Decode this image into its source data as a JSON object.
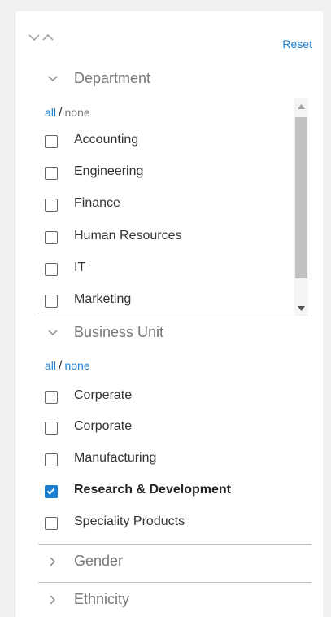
{
  "header": {
    "reset_label": "Reset"
  },
  "sections": [
    {
      "title": "Department",
      "all_label": "all",
      "slash": "/",
      "none_label": "none",
      "items": [
        {
          "label": "Accounting",
          "checked": false
        },
        {
          "label": "Engineering",
          "checked": false
        },
        {
          "label": "Finance",
          "checked": false
        },
        {
          "label": "Human Resources",
          "checked": false
        },
        {
          "label": "IT",
          "checked": false
        },
        {
          "label": "Marketing",
          "checked": false
        }
      ]
    },
    {
      "title": "Business Unit",
      "all_label": "all",
      "slash": "/",
      "none_label": "none",
      "items": [
        {
          "label": "Corperate",
          "checked": false
        },
        {
          "label": "Corporate",
          "checked": false
        },
        {
          "label": "Manufacturing",
          "checked": false
        },
        {
          "label": "Research & Development",
          "checked": true
        },
        {
          "label": "Speciality Products",
          "checked": false
        }
      ]
    },
    {
      "title": "Gender"
    },
    {
      "title": "Ethnicity"
    }
  ],
  "colors": {
    "accent": "#1a7fd1",
    "muted": "#777777",
    "divider": "#bdbdbd"
  }
}
